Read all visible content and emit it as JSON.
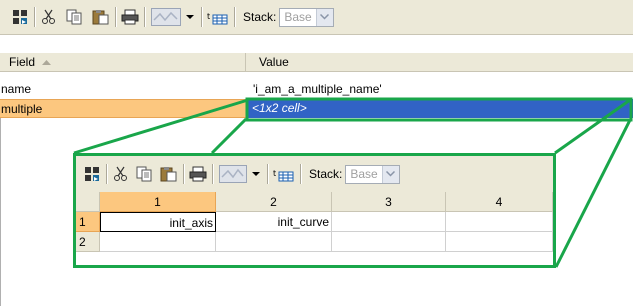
{
  "main_toolbar": {
    "stack_label": "Stack:",
    "stack_value": "Base",
    "icons": [
      "import-data-icon",
      "cut-icon",
      "copy-icon",
      "paste-icon",
      "print-icon",
      "plot-icon",
      "plot-dropdown-icon",
      "insert-table-icon"
    ]
  },
  "struct_table": {
    "headers": {
      "field": "Field",
      "value": "Value"
    },
    "rows": [
      {
        "field": "name",
        "value": "'i_am_a_multiple_name'"
      },
      {
        "field": "multiple",
        "value": "<1x2 cell>"
      }
    ]
  },
  "inset": {
    "toolbar": {
      "stack_label": "Stack:",
      "stack_value": "Base"
    },
    "columns": [
      "1",
      "2",
      "3",
      "4"
    ],
    "rows": [
      {
        "index": "1",
        "cells": [
          "init_axis",
          "init_curve",
          "",
          ""
        ]
      },
      {
        "index": "2",
        "cells": [
          "",
          "",
          "",
          ""
        ]
      }
    ]
  },
  "colors": {
    "callout_green": "#19a64a",
    "selected_blue": "#3163c5",
    "selected_orange": "#fcc77f",
    "toolbar_bg": "#ece9d8"
  }
}
